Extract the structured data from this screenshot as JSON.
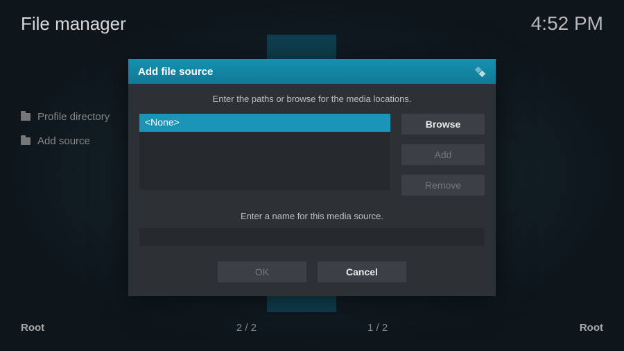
{
  "header": {
    "title": "File manager",
    "clock": "4:52 PM"
  },
  "sidebar": {
    "items": [
      {
        "label": "Profile directory"
      },
      {
        "label": "Add source"
      }
    ]
  },
  "footer": {
    "root_left": "Root",
    "count_left": "2 / 2",
    "count_right": "1 / 2",
    "root_right": "Root"
  },
  "dialog": {
    "title": "Add file source",
    "instruction": "Enter the paths or browse for the media locations.",
    "path_value": "<None>",
    "browse_label": "Browse",
    "add_label": "Add",
    "remove_label": "Remove",
    "name_label": "Enter a name for this media source.",
    "name_value": "",
    "ok_label": "OK",
    "cancel_label": "Cancel"
  }
}
